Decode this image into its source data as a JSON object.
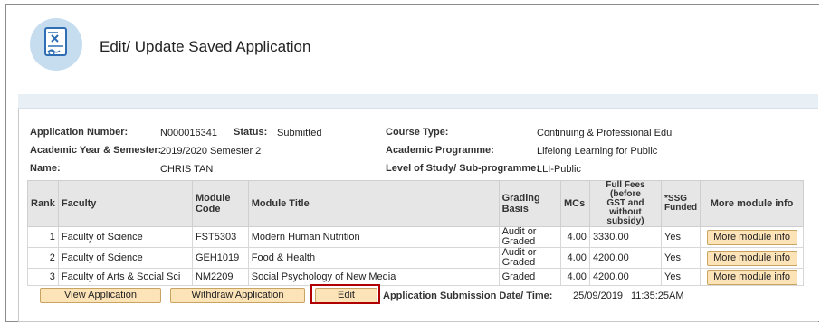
{
  "page": {
    "title": "Edit/ Update Saved Application",
    "icon": "application-edit-icon"
  },
  "application": {
    "number_label": "Application Number:",
    "number_value": "N000016341",
    "status_label": "Status:",
    "status_value": "Submitted",
    "course_type_label": "Course Type:",
    "course_type_value": "Continuing & Professional Edu",
    "year_sem_label": "Academic Year & Semester:",
    "year_sem_value": "2019/2020 Semester 2",
    "programme_label": "Academic Programme:",
    "programme_value": "Lifelong Learning for Public",
    "name_label": "Name:",
    "name_value": "CHRIS TAN",
    "level_label": "Level of Study/ Sub-programme:",
    "level_value": "LLI-Public"
  },
  "table": {
    "headers": {
      "rank": "Rank",
      "faculty": "Faculty",
      "module_code": "Module Code",
      "module_title": "Module Title",
      "grading_basis": "Grading Basis",
      "mcs": "MCs",
      "fees_line1": "Full Fees (before",
      "fees_line2": "GST and without",
      "fees_line3": "subsidy)",
      "ssg_line1": "*SSG",
      "ssg_line2": "Funded",
      "more": "More module info"
    },
    "rows": [
      {
        "rank": "1",
        "faculty": "Faculty of Science",
        "code": "FST5303",
        "title": "Modern Human Nutrition",
        "grading_1": "Audit or",
        "grading_2": "Graded",
        "mcs": "4.00",
        "fees": "3330.00",
        "ssg": "Yes",
        "more": "More module info"
      },
      {
        "rank": "2",
        "faculty": "Faculty of Science",
        "code": "GEH1019",
        "title": "Food & Health",
        "grading_1": "Audit or",
        "grading_2": "Graded",
        "mcs": "4.00",
        "fees": "4200.00",
        "ssg": "Yes",
        "more": "More module info"
      },
      {
        "rank": "3",
        "faculty": "Faculty of Arts & Social Sci",
        "code": "NM2209",
        "title": "Social Psychology of New Media",
        "grading_1": "Graded",
        "grading_2": "",
        "mcs": "4.00",
        "fees": "4200.00",
        "ssg": "Yes",
        "more": "More module info"
      }
    ]
  },
  "actions": {
    "view": "View Application",
    "withdraw": "Withdraw Application",
    "edit": "Edit"
  },
  "submission": {
    "label": "Application Submission Date/ Time:",
    "date": "25/09/2019",
    "time": "11:35:25AM"
  },
  "colors": {
    "button_bg": "#fde3b8",
    "button_border": "#c9a461",
    "highlight": "#b00000",
    "icon_bg": "#c6dcef"
  }
}
